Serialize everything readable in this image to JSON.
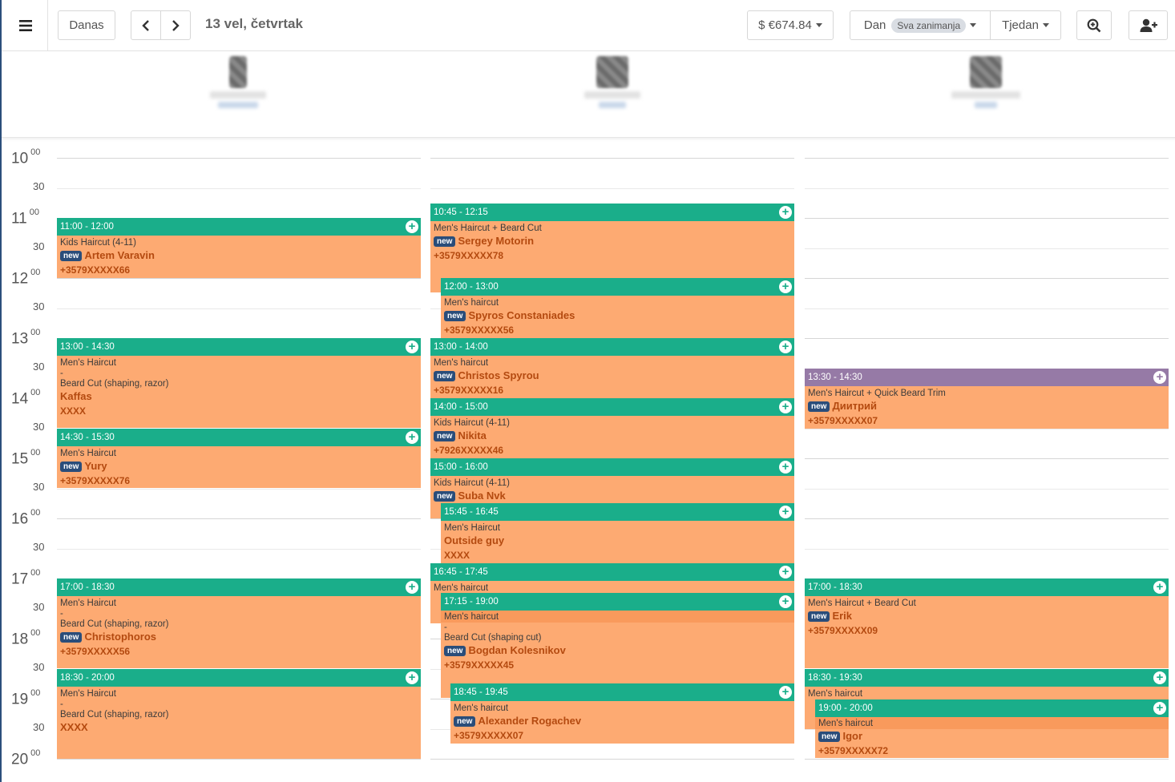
{
  "toolbar": {
    "today_label": "Danas",
    "date_label": "13 vel, četvrtak",
    "revenue_label": "$ €674.84",
    "view_day_label": "Dan",
    "occupations_pill": "Sva zanimanja",
    "view_week_label": "Tjedan"
  },
  "times": {
    "h10": "10",
    "h11": "11",
    "h12": "12",
    "h13": "13",
    "h14": "14",
    "h15": "15",
    "h16": "16",
    "h17": "17",
    "h18": "18",
    "h19": "19",
    "h20": "20",
    "min00": "00",
    "min30": "30"
  },
  "events": {
    "c1_1100": {
      "time": "11:00 - 12:00",
      "service": "Kids Haircut (4-11)",
      "badge": "new",
      "client": "Artem Varavin",
      "phone": "+3579XXXXX66"
    },
    "c1_1300": {
      "time": "13:00 - 14:30",
      "service1": "Men's Haircut",
      "sep": "-",
      "service2": "Beard Cut (shaping, razor)",
      "client": "Kaffas",
      "phone": "XXXX"
    },
    "c1_1430": {
      "time": "14:30 - 15:30",
      "service": "Men's Haircut",
      "badge": "new",
      "client": "Yury",
      "phone": "+3579XXXXX76"
    },
    "c1_1700": {
      "time": "17:00 - 18:30",
      "service1": "Men's Haircut",
      "sep": "-",
      "service2": "Beard Cut (shaping, razor)",
      "badge": "new",
      "client": "Christophoros",
      "phone": "+3579XXXXX56"
    },
    "c1_1830": {
      "time": "18:30 - 20:00",
      "service1": "Men's Haircut",
      "sep": "-",
      "service2": "Beard Cut (shaping, razor)",
      "client": "XXXX"
    },
    "c2_1045": {
      "time": "10:45 - 12:15",
      "service": "Men's Haircut + Beard Cut",
      "badge": "new",
      "client": "Sergey Motorin",
      "phone": "+3579XXXXX78"
    },
    "c2_1200": {
      "time": "12:00 - 13:00",
      "service": "Men's haircut",
      "badge": "new",
      "client": "Spyros Constaniades",
      "phone": "+3579XXXXX56"
    },
    "c2_1300": {
      "time": "13:00 - 14:00",
      "service": "Men's haircut",
      "badge": "new",
      "client": "Christos Spyrou",
      "phone": "+3579XXXXX16"
    },
    "c2_1400": {
      "time": "14:00 - 15:00",
      "service": "Kids Haircut (4-11)",
      "badge": "new",
      "client": "Nikita",
      "phone": "+7926XXXXX46"
    },
    "c2_1500": {
      "time": "15:00 - 16:00",
      "service": "Kids Haircut (4-11)",
      "badge": "new",
      "client": "Suba Nvk"
    },
    "c2_1545": {
      "time": "15:45 - 16:45",
      "service": "Men's Haircut",
      "client": "Outside guy",
      "phone": "XXXX"
    },
    "c2_1645": {
      "time": "16:45 - 17:45",
      "service": "Men's haircut"
    },
    "c2_1715": {
      "time": "17:15 - 19:00",
      "service1": "Men's haircut",
      "sep": "-",
      "service2": "Beard Cut (shaping cut)",
      "badge": "new",
      "client": "Bogdan Kolesnikov",
      "phone": "+3579XXXXX45"
    },
    "c2_1845": {
      "time": "18:45 - 19:45",
      "service": "Men's haircut",
      "badge": "new",
      "client": "Alexander Rogachev",
      "phone": "+3579XXXXX07"
    },
    "c3_1330": {
      "time": "13:30 - 14:30",
      "service": "Men's Haircut + Quick Beard Trim",
      "badge": "new",
      "client": "Диитрий",
      "phone": "+3579XXXXX07"
    },
    "c3_1700": {
      "time": "17:00 - 18:30",
      "service": "Men's Haircut + Beard Cut",
      "badge": "new",
      "client": "Erik",
      "phone": "+3579XXXXX09"
    },
    "c3_1830": {
      "time": "18:30 - 19:30",
      "service": "Men's haircut"
    },
    "c3_1900": {
      "time": "19:00 - 20:00",
      "service": "Men's haircut",
      "badge": "new",
      "client": "Igor",
      "phone": "+3579XXXXX72"
    }
  },
  "colors": {
    "header_green": "#1aae8a",
    "header_purple": "#967aa6",
    "event_bg": "#fdaa72",
    "client_text": "#b44a10",
    "badge": "#2a4d7a"
  },
  "icons": [
    "hamburger-icon",
    "chevron-left-icon",
    "chevron-right-icon",
    "zoom-in-icon",
    "add-user-icon",
    "plus-circle-icon"
  ]
}
